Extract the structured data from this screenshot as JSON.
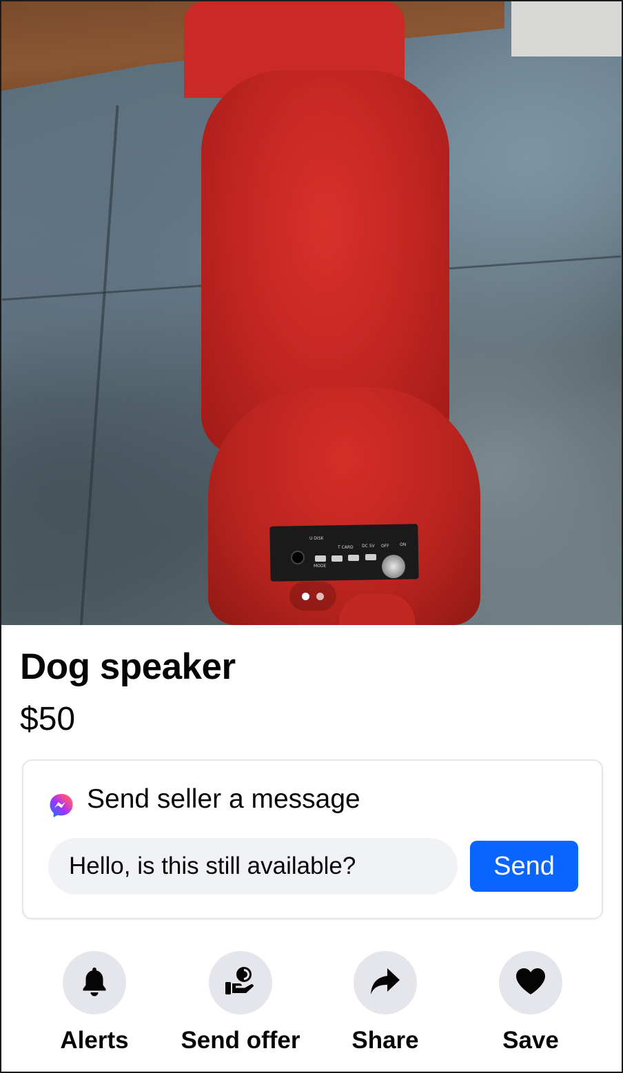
{
  "listing": {
    "title": "Dog speaker",
    "price": "$50",
    "photo_count": 2,
    "active_photo_index": 0,
    "photo_description_icon": "listing-photo"
  },
  "panel_labels": {
    "udisk": "U DISK",
    "tcard": "T CARD",
    "dc": "DC 5V",
    "off": "OFF",
    "on": "ON",
    "mode": "MODE"
  },
  "message": {
    "heading": "Send seller a message",
    "input_value": "Hello, is this still available?",
    "send_label": "Send",
    "icon": "messenger-icon"
  },
  "actions": [
    {
      "label": "Alerts",
      "icon": "bell-icon"
    },
    {
      "label": "Send offer",
      "icon": "offer-icon"
    },
    {
      "label": "Share",
      "icon": "share-icon"
    },
    {
      "label": "Save",
      "icon": "heart-icon"
    }
  ],
  "colors": {
    "accent": "#0866ff",
    "action_circle": "#e4e6eb",
    "input_bg": "#f0f2f5",
    "text": "#050505"
  }
}
